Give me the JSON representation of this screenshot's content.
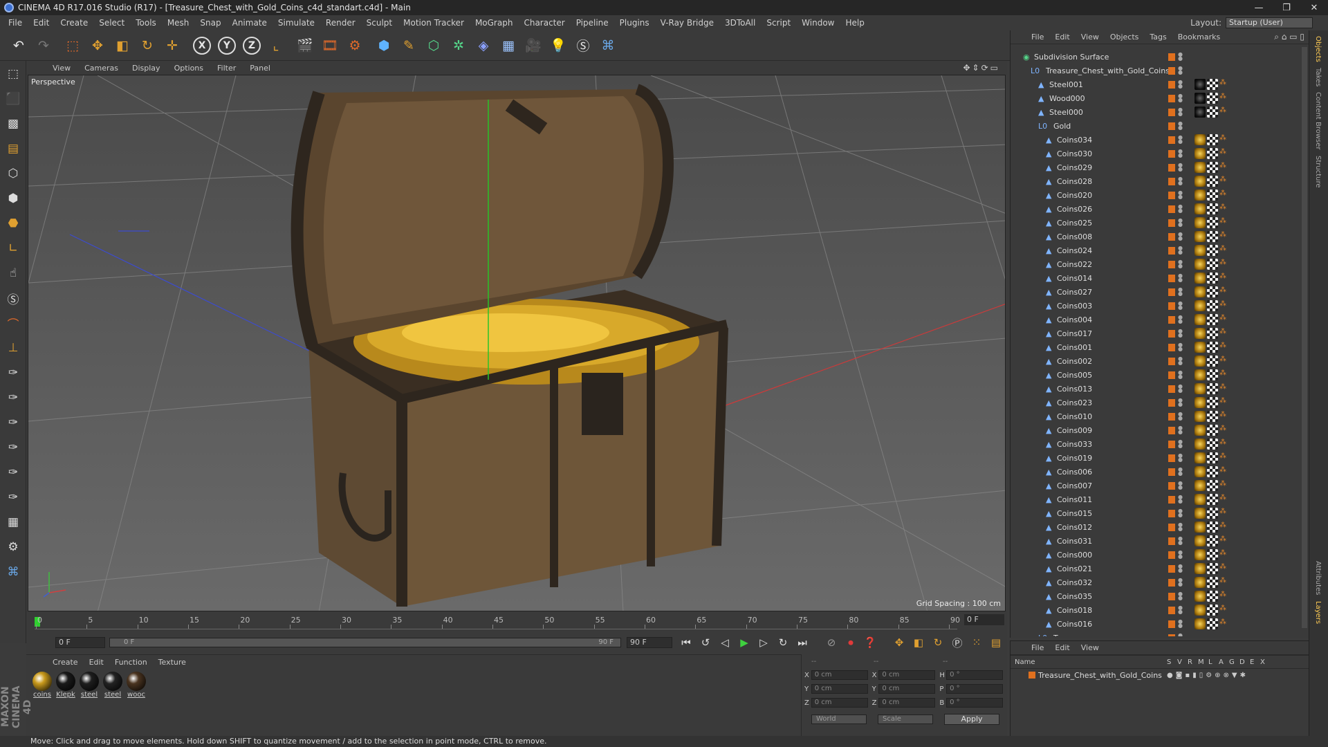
{
  "window": {
    "title": "CINEMA 4D R17.016 Studio (R17) - [Treasure_Chest_with_Gold_Coins_c4d_standart.c4d] - Main",
    "controls": [
      "—",
      "❐",
      "✕"
    ]
  },
  "menu": [
    "File",
    "Edit",
    "Create",
    "Select",
    "Tools",
    "Mesh",
    "Snap",
    "Animate",
    "Simulate",
    "Render",
    "Sculpt",
    "Motion Tracker",
    "MoGraph",
    "Character",
    "Pipeline",
    "Plugins",
    "V-Ray Bridge",
    "3DToAll",
    "Script",
    "Window",
    "Help"
  ],
  "layout": {
    "label": "Layout:",
    "value": "Startup (User)"
  },
  "toolbar_axes": [
    "X",
    "Y",
    "Z"
  ],
  "viewport": {
    "menu": [
      "View",
      "Cameras",
      "Display",
      "Options",
      "Filter",
      "Panel"
    ],
    "label": "Perspective",
    "grid_spacing": "Grid Spacing : 100 cm"
  },
  "timeline": {
    "ticks": [
      "0",
      "5",
      "10",
      "15",
      "20",
      "25",
      "30",
      "35",
      "40",
      "45",
      "50",
      "55",
      "60",
      "65",
      "70",
      "75",
      "80",
      "85",
      "90"
    ],
    "current_frame": "0 F"
  },
  "playback": {
    "start": "0 F",
    "slider_left": "0 F",
    "slider_right": "90 F",
    "end": "90 F"
  },
  "materials": {
    "menu": [
      "Create",
      "Edit",
      "Function",
      "Texture"
    ],
    "items": [
      {
        "label": "coins",
        "color": "#c99a1c"
      },
      {
        "label": "Klepk",
        "color": "#1a1a1a"
      },
      {
        "label": "steel",
        "color": "#1e1e1e"
      },
      {
        "label": "steel",
        "color": "#222222"
      },
      {
        "label": "wooc",
        "color": "#4a3420"
      }
    ]
  },
  "coordinates": {
    "header": "--",
    "header2": "--",
    "header3": "--",
    "rows": [
      {
        "a": "X",
        "v1": "0 cm",
        "b": "X",
        "v2": "0 cm",
        "c": "H",
        "v3": "0 °"
      },
      {
        "a": "Y",
        "v1": "0 cm",
        "b": "Y",
        "v2": "0 cm",
        "c": "P",
        "v3": "0 °"
      },
      {
        "a": "Z",
        "v1": "0 cm",
        "b": "Z",
        "v2": "0 cm",
        "c": "B",
        "v3": "0 °"
      }
    ],
    "world": "World",
    "scale": "Scale",
    "apply": "Apply"
  },
  "objects": {
    "menu": [
      "File",
      "Edit",
      "View",
      "Objects",
      "Tags",
      "Bookmarks"
    ],
    "tree": [
      {
        "name": "Subdivision Surface",
        "indent": 0,
        "tag": "none"
      },
      {
        "name": "Treasure_Chest_with_Gold_Coins",
        "indent": 1,
        "tag": "none"
      },
      {
        "name": "Steel001",
        "indent": 2,
        "tag": "dark"
      },
      {
        "name": "Wood000",
        "indent": 2,
        "tag": "dark"
      },
      {
        "name": "Steel000",
        "indent": 2,
        "tag": "dark"
      },
      {
        "name": "Gold",
        "indent": 2,
        "tag": "none"
      },
      {
        "name": "Coins034",
        "indent": 3,
        "tag": "gold"
      },
      {
        "name": "Coins030",
        "indent": 3,
        "tag": "gold"
      },
      {
        "name": "Coins029",
        "indent": 3,
        "tag": "gold"
      },
      {
        "name": "Coins028",
        "indent": 3,
        "tag": "gold"
      },
      {
        "name": "Coins020",
        "indent": 3,
        "tag": "gold"
      },
      {
        "name": "Coins026",
        "indent": 3,
        "tag": "gold"
      },
      {
        "name": "Coins025",
        "indent": 3,
        "tag": "gold"
      },
      {
        "name": "Coins008",
        "indent": 3,
        "tag": "gold"
      },
      {
        "name": "Coins024",
        "indent": 3,
        "tag": "gold"
      },
      {
        "name": "Coins022",
        "indent": 3,
        "tag": "gold"
      },
      {
        "name": "Coins014",
        "indent": 3,
        "tag": "gold"
      },
      {
        "name": "Coins027",
        "indent": 3,
        "tag": "gold"
      },
      {
        "name": "Coins003",
        "indent": 3,
        "tag": "gold"
      },
      {
        "name": "Coins004",
        "indent": 3,
        "tag": "gold"
      },
      {
        "name": "Coins017",
        "indent": 3,
        "tag": "gold"
      },
      {
        "name": "Coins001",
        "indent": 3,
        "tag": "gold"
      },
      {
        "name": "Coins002",
        "indent": 3,
        "tag": "gold"
      },
      {
        "name": "Coins005",
        "indent": 3,
        "tag": "gold"
      },
      {
        "name": "Coins013",
        "indent": 3,
        "tag": "gold"
      },
      {
        "name": "Coins023",
        "indent": 3,
        "tag": "gold"
      },
      {
        "name": "Coins010",
        "indent": 3,
        "tag": "gold"
      },
      {
        "name": "Coins009",
        "indent": 3,
        "tag": "gold"
      },
      {
        "name": "Coins033",
        "indent": 3,
        "tag": "gold"
      },
      {
        "name": "Coins019",
        "indent": 3,
        "tag": "gold"
      },
      {
        "name": "Coins006",
        "indent": 3,
        "tag": "gold"
      },
      {
        "name": "Coins007",
        "indent": 3,
        "tag": "gold"
      },
      {
        "name": "Coins011",
        "indent": 3,
        "tag": "gold"
      },
      {
        "name": "Coins015",
        "indent": 3,
        "tag": "gold"
      },
      {
        "name": "Coins012",
        "indent": 3,
        "tag": "gold"
      },
      {
        "name": "Coins031",
        "indent": 3,
        "tag": "gold"
      },
      {
        "name": "Coins000",
        "indent": 3,
        "tag": "gold"
      },
      {
        "name": "Coins021",
        "indent": 3,
        "tag": "gold"
      },
      {
        "name": "Coins032",
        "indent": 3,
        "tag": "gold"
      },
      {
        "name": "Coins035",
        "indent": 3,
        "tag": "gold"
      },
      {
        "name": "Coins018",
        "indent": 3,
        "tag": "gold"
      },
      {
        "name": "Coins016",
        "indent": 3,
        "tag": "gold"
      },
      {
        "name": "Top",
        "indent": 2,
        "tag": "none"
      }
    ]
  },
  "dock_tabs": [
    "Objects",
    "Takes",
    "Content Browser",
    "Structure",
    "Attributes",
    "Layers"
  ],
  "layers": {
    "menu": [
      "File",
      "Edit",
      "View"
    ],
    "header_name": "Name",
    "flags": [
      "S",
      "V",
      "R",
      "M",
      "L",
      "A",
      "G",
      "D",
      "E",
      "X"
    ],
    "row": "Treasure_Chest_with_Gold_Coins"
  },
  "status": "Move: Click and drag to move elements. Hold down SHIFT to quantize movement / add to the selection in point mode, CTRL to remove.",
  "branding": "MAXON CINEMA 4D"
}
